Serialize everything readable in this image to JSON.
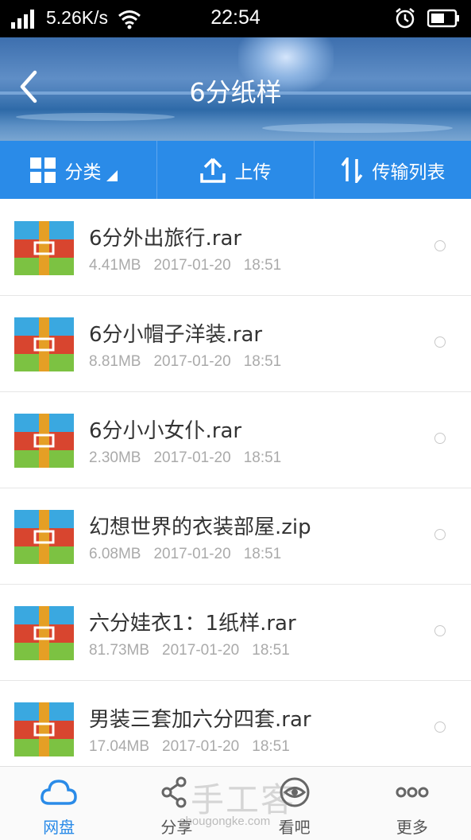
{
  "status_bar": {
    "network_speed": "5.26K/s",
    "time": "22:54",
    "icons": [
      "signal-icon",
      "wifi-icon",
      "alarm-icon",
      "battery-icon"
    ]
  },
  "header": {
    "title": "6分纸样",
    "back_icon": "chevron-left-icon"
  },
  "toolbar": {
    "category_label": "分类",
    "upload_label": "上传",
    "transfer_label": "传输列表",
    "accent_color": "#2a8be8"
  },
  "files": [
    {
      "name": "6分外出旅行.rar",
      "size": "4.41MB",
      "date": "2017-01-20",
      "time": "18:51"
    },
    {
      "name": "6分小帽子洋装.rar",
      "size": "8.81MB",
      "date": "2017-01-20",
      "time": "18:51"
    },
    {
      "name": "6分小小女仆.rar",
      "size": "2.30MB",
      "date": "2017-01-20",
      "time": "18:51"
    },
    {
      "name": "幻想世界的衣装部屋.zip",
      "size": "6.08MB",
      "date": "2017-01-20",
      "time": "18:51"
    },
    {
      "name": "六分娃衣1：1纸样.rar",
      "size": "81.73MB",
      "date": "2017-01-20",
      "time": "18:51"
    },
    {
      "name": "男装三套加六分四套.rar",
      "size": "17.04MB",
      "date": "2017-01-20",
      "time": "18:51"
    }
  ],
  "bottom_nav": {
    "items": [
      {
        "label": "网盘",
        "icon": "cloud-icon",
        "active": true
      },
      {
        "label": "分享",
        "icon": "share-icon",
        "active": false
      },
      {
        "label": "看吧",
        "icon": "eye-icon",
        "active": false
      },
      {
        "label": "更多",
        "icon": "more-icon",
        "active": false
      }
    ]
  },
  "watermark": {
    "text": "手工客",
    "url": "shougongke.com"
  }
}
